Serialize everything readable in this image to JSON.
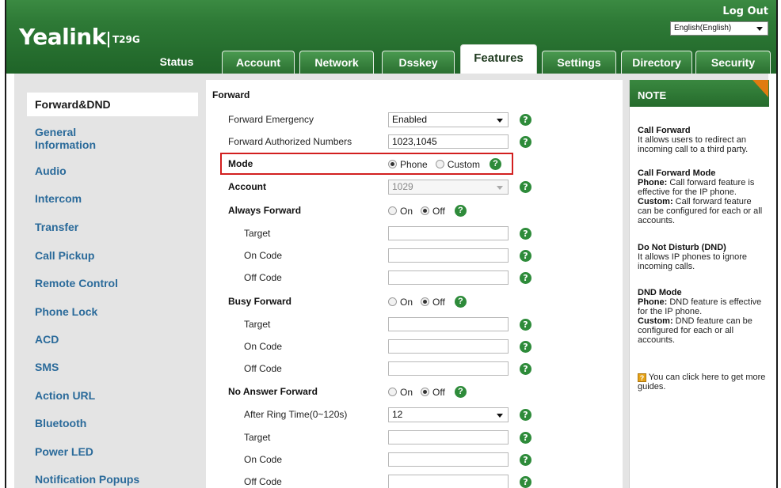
{
  "header": {
    "logo": "Yealink",
    "model": "T29G",
    "logout": "Log Out",
    "language": "English(English)"
  },
  "tabs": [
    {
      "label": "Status"
    },
    {
      "label": "Account"
    },
    {
      "label": "Network"
    },
    {
      "label": "Dsskey"
    },
    {
      "label": "Features"
    },
    {
      "label": "Settings"
    },
    {
      "label": "Directory"
    },
    {
      "label": "Security"
    }
  ],
  "active_tab": "Features",
  "sidebar": {
    "items": [
      {
        "label": "Forward&DND"
      },
      {
        "label": "General Information"
      },
      {
        "label": "Audio"
      },
      {
        "label": "Intercom"
      },
      {
        "label": "Transfer"
      },
      {
        "label": "Call Pickup"
      },
      {
        "label": "Remote Control"
      },
      {
        "label": "Phone Lock"
      },
      {
        "label": "ACD"
      },
      {
        "label": "SMS"
      },
      {
        "label": "Action URL"
      },
      {
        "label": "Bluetooth"
      },
      {
        "label": "Power LED"
      },
      {
        "label": "Notification Popups"
      }
    ]
  },
  "form": {
    "section_title": "Forward",
    "forward_emergency": {
      "label": "Forward Emergency",
      "value": "Enabled"
    },
    "forward_authorized": {
      "label": "Forward Authorized Numbers",
      "value": "1023,1045"
    },
    "mode": {
      "label": "Mode",
      "option_phone": "Phone",
      "option_custom": "Custom",
      "selected": "Phone"
    },
    "account": {
      "label": "Account",
      "value": "1029"
    },
    "always_forward": {
      "label": "Always Forward",
      "on": "On",
      "off": "Off",
      "selected": "Off",
      "target": "Target",
      "on_code": "On Code",
      "off_code": "Off Code"
    },
    "busy_forward": {
      "label": "Busy Forward",
      "on": "On",
      "off": "Off",
      "selected": "Off",
      "target": "Target",
      "on_code": "On Code",
      "off_code": "Off Code"
    },
    "no_answer_forward": {
      "label": "No Answer Forward",
      "on": "On",
      "off": "Off",
      "selected": "Off",
      "ring_time": "After Ring Time(0~120s)",
      "ring_value": "12",
      "target": "Target",
      "on_code": "On Code",
      "off_code": "Off Code"
    }
  },
  "note": {
    "title": "NOTE",
    "call_forward_title": "Call Forward",
    "call_forward_text": "It allows users to redirect an incoming call to a third party.",
    "mode_title": "Call Forward Mode",
    "mode_phone_label": "Phone:",
    "mode_phone_text": " Call forward feature is effective for the IP phone.",
    "mode_custom_label": "Custom:",
    "mode_custom_text": " Call forward feature can be configured for each or all accounts.",
    "dnd_title": "Do Not Disturb (DND)",
    "dnd_text": "It allows IP phones to ignore incoming calls.",
    "dnd_mode_title": "DND Mode",
    "dnd_phone_label": "Phone:",
    "dnd_phone_text": " DND feature is effective for the IP phone.",
    "dnd_custom_label": "Custom:",
    "dnd_custom_text": " DND feature can be configured for each or all accounts.",
    "guide_icon": "?",
    "guide_text": " You can click here to get more guides."
  },
  "colors": {
    "header_green": "#2e7a36",
    "link_blue": "#2a6a9a",
    "help_green": "#2e8b3a",
    "highlight_red": "#d21f1f",
    "note_corner": "#e07b10"
  }
}
